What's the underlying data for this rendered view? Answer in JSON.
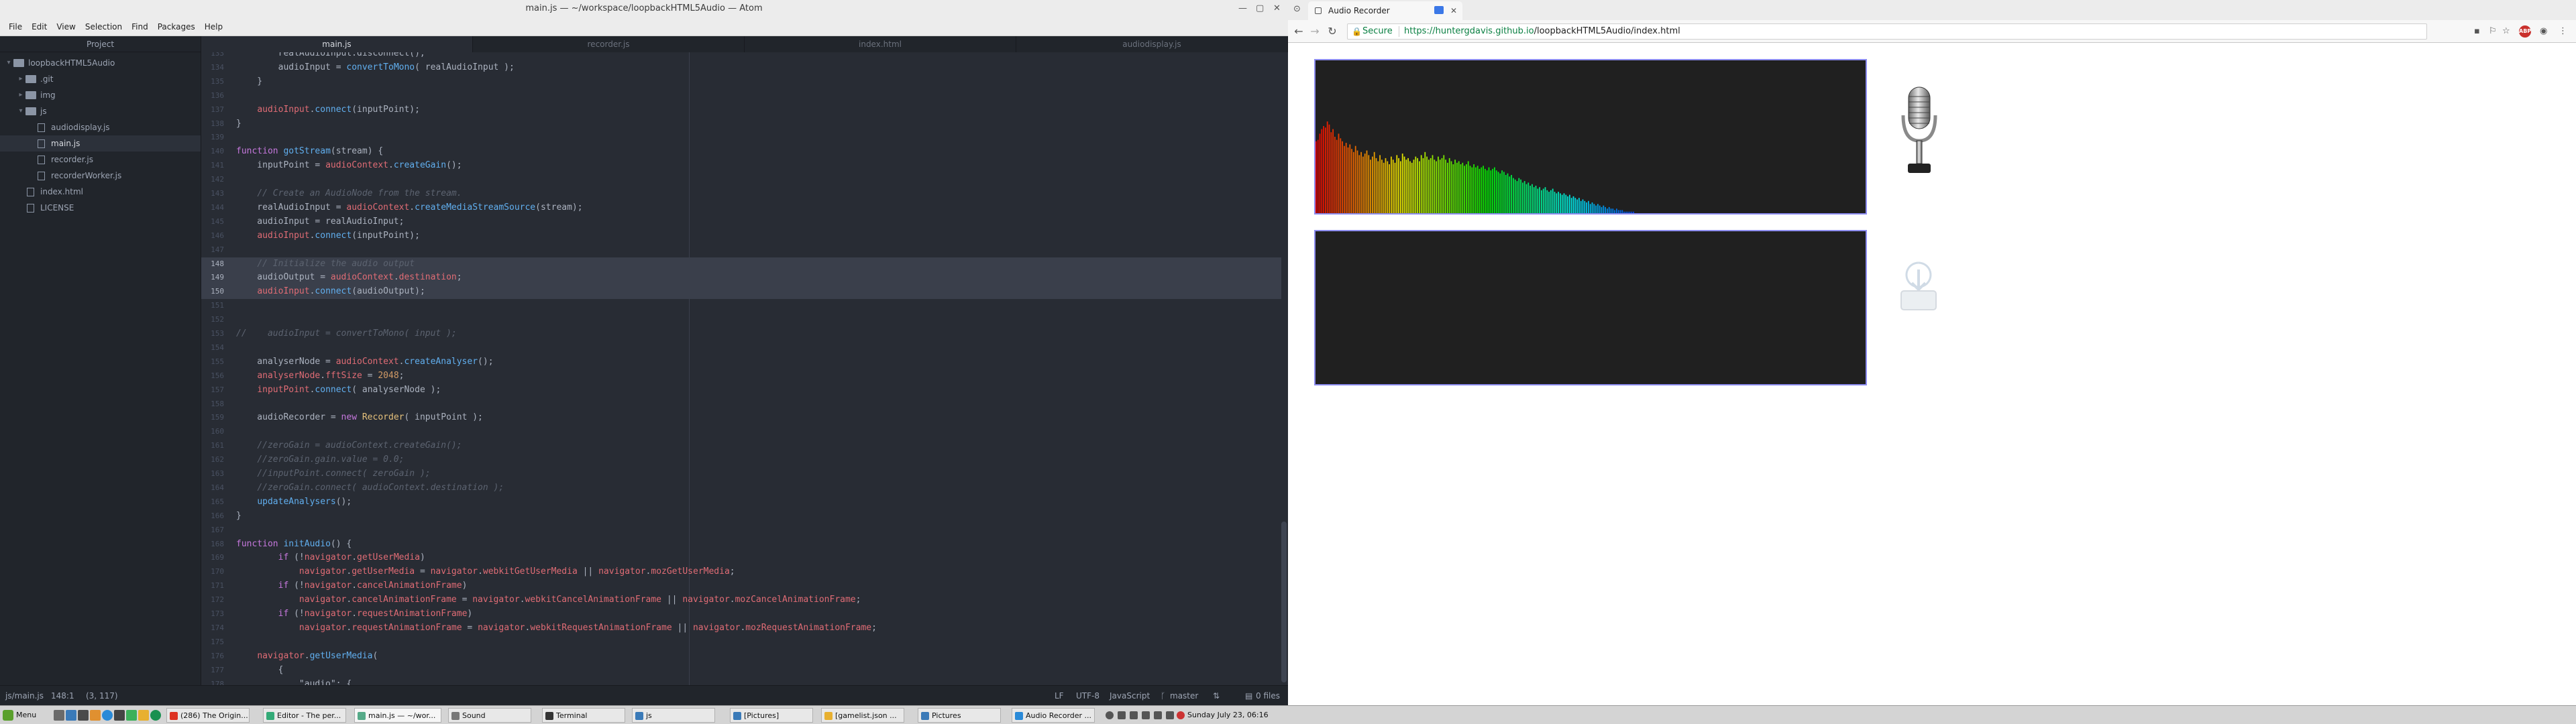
{
  "atom": {
    "title": "main.js — ~/workspace/loopbackHTML5Audio — Atom",
    "menu": [
      "File",
      "Edit",
      "View",
      "Selection",
      "Find",
      "Packages",
      "Help"
    ],
    "tree": {
      "header": "Project",
      "root": "loopbackHTML5Audio",
      "items": [
        {
          "name": ".git",
          "kind": "folder"
        },
        {
          "name": "img",
          "kind": "folder"
        },
        {
          "name": "js",
          "kind": "folder-open"
        },
        {
          "name": "audiodisplay.js",
          "kind": "file"
        },
        {
          "name": "main.js",
          "kind": "file"
        },
        {
          "name": "recorder.js",
          "kind": "file"
        },
        {
          "name": "recorderWorker.js",
          "kind": "file"
        },
        {
          "name": "index.html",
          "kind": "file"
        },
        {
          "name": "LICENSE",
          "kind": "file"
        }
      ]
    },
    "tabs": [
      "main.js",
      "recorder.js",
      "index.html",
      "audiodisplay.js"
    ],
    "status": {
      "path": "js/main.js",
      "position": "148:1",
      "selection": "(3, 117)",
      "line_ending": "LF",
      "encoding": "UTF-8",
      "grammar": "JavaScript",
      "branch": "master",
      "files": "0 files"
    },
    "code": [
      {
        "n": "133",
        "html": "        realAudioInput.disconnect();"
      },
      {
        "n": "134",
        "html": "        audioInput = <span class='fn'>convertToMono</span>( realAudioInput );"
      },
      {
        "n": "135",
        "html": "    }"
      },
      {
        "n": "136",
        "html": ""
      },
      {
        "n": "137",
        "html": "    <span class='pr'>audioInput</span>.<span class='fn'>connect</span>(inputPoint);"
      },
      {
        "n": "138",
        "html": "}"
      },
      {
        "n": "139",
        "html": ""
      },
      {
        "n": "140",
        "html": "<span class='kw'>function</span> <span class='fn'>gotStream</span>(stream) {"
      },
      {
        "n": "141",
        "html": "    inputPoint = <span class='pr'>audioContext</span>.<span class='fn'>createGain</span>();"
      },
      {
        "n": "142",
        "html": ""
      },
      {
        "n": "143",
        "html": "    <span class='cm'>// Create an AudioNode from the stream.</span>"
      },
      {
        "n": "144",
        "html": "    realAudioInput = <span class='pr'>audioContext</span>.<span class='fn'>createMediaStreamSource</span>(stream);"
      },
      {
        "n": "145",
        "html": "    audioInput = realAudioInput;"
      },
      {
        "n": "146",
        "html": "    <span class='pr'>audioInput</span>.<span class='fn'>connect</span>(inputPoint);"
      },
      {
        "n": "147",
        "html": ""
      },
      {
        "n": "148",
        "html": "    <span class='cm'>// Initialize the audio output</span>",
        "hl": true
      },
      {
        "n": "149",
        "html": "    audioOutput = <span class='pr'>audioContext</span>.<span class='pr'>destination</span>;",
        "hl": true
      },
      {
        "n": "150",
        "html": "    <span class='pr'>audioInput</span>.<span class='fn'>connect</span>(audioOutput);",
        "hl": true
      },
      {
        "n": "151",
        "html": ""
      },
      {
        "n": "152",
        "html": ""
      },
      {
        "n": "153",
        "html": "<span class='cm'>//    audioInput = convertToMono( input );</span>"
      },
      {
        "n": "154",
        "html": ""
      },
      {
        "n": "155",
        "html": "    analyserNode = <span class='pr'>audioContext</span>.<span class='fn'>createAnalyser</span>();"
      },
      {
        "n": "156",
        "html": "    <span class='pr'>analyserNode</span>.<span class='pr'>fftSize</span> = <span class='nm'>2048</span>;"
      },
      {
        "n": "157",
        "html": "    <span class='pr'>inputPoint</span>.<span class='fn'>connect</span>( analyserNode );"
      },
      {
        "n": "158",
        "html": ""
      },
      {
        "n": "159",
        "html": "    audioRecorder = <span class='kw'>new</span> <span class='cls'>Recorder</span>( inputPoint );"
      },
      {
        "n": "160",
        "html": ""
      },
      {
        "n": "161",
        "html": "    <span class='cm'>//zeroGain = audioContext.createGain();</span>"
      },
      {
        "n": "162",
        "html": "    <span class='cm'>//zeroGain.gain.value = 0.0;</span>"
      },
      {
        "n": "163",
        "html": "    <span class='cm'>//inputPoint.connect( zeroGain );</span>"
      },
      {
        "n": "164",
        "html": "    <span class='cm'>//zeroGain.connect( audioContext.destination );</span>"
      },
      {
        "n": "165",
        "html": "    <span class='fn'>updateAnalysers</span>();"
      },
      {
        "n": "166",
        "html": "}"
      },
      {
        "n": "167",
        "html": ""
      },
      {
        "n": "168",
        "html": "<span class='kw'>function</span> <span class='fn'>initAudio</span>() {"
      },
      {
        "n": "169",
        "html": "        <span class='kw'>if</span> (!<span class='pr'>navigator</span>.<span class='pr'>getUserMedia</span>)"
      },
      {
        "n": "170",
        "html": "            <span class='pr'>navigator</span>.<span class='pr'>getUserMedia</span> = <span class='pr'>navigator</span>.<span class='pr'>webkitGetUserMedia</span> || <span class='pr'>navigator</span>.<span class='pr'>mozGetUserMedia</span>;"
      },
      {
        "n": "171",
        "html": "        <span class='kw'>if</span> (!<span class='pr'>navigator</span>.<span class='pr'>cancelAnimationFrame</span>)"
      },
      {
        "n": "172",
        "html": "            <span class='pr'>navigator</span>.<span class='pr'>cancelAnimationFrame</span> = <span class='pr'>navigator</span>.<span class='pr'>webkitCancelAnimationFrame</span> || <span class='pr'>navigator</span>.<span class='pr'>mozCancelAnimationFrame</span>;"
      },
      {
        "n": "173",
        "html": "        <span class='kw'>if</span> (!<span class='pr'>navigator</span>.<span class='pr'>requestAnimationFrame</span>)"
      },
      {
        "n": "174",
        "html": "            <span class='pr'>navigator</span>.<span class='pr'>requestAnimationFrame</span> = <span class='pr'>navigator</span>.<span class='pr'>webkitRequestAnimationFrame</span> || <span class='pr'>navigator</span>.<span class='pr'>mozRequestAnimationFrame</span>;"
      },
      {
        "n": "175",
        "html": ""
      },
      {
        "n": "176",
        "html": "    <span class='pr'>navigator</span>.<span class='fn'>getUserMedia</span>("
      },
      {
        "n": "177",
        "html": "        {"
      },
      {
        "n": "178",
        "html": "            <span class='str'>\"audio\"</span>: {"
      }
    ]
  },
  "chrome": {
    "tab_title": "Audio Recorder",
    "secure_label": "Secure",
    "url_prefix": "https://huntergdavis.github.io",
    "url_path": "/loopbackHTML5Audio/index.html",
    "abp_label": "ABP",
    "spectrum_levels": [
      0.47,
      0.48,
      0.52,
      0.55,
      0.57,
      0.56,
      0.6,
      0.58,
      0.53,
      0.55,
      0.5,
      0.48,
      0.52,
      0.49,
      0.47,
      0.44,
      0.46,
      0.43,
      0.45,
      0.42,
      0.4,
      0.44,
      0.41,
      0.38,
      0.4,
      0.37,
      0.39,
      0.41,
      0.38,
      0.35,
      0.37,
      0.4,
      0.36,
      0.34,
      0.38,
      0.35,
      0.33,
      0.36,
      0.34,
      0.32,
      0.37,
      0.35,
      0.33,
      0.38,
      0.36,
      0.34,
      0.39,
      0.37,
      0.35,
      0.36,
      0.34,
      0.33,
      0.35,
      0.37,
      0.36,
      0.34,
      0.38,
      0.36,
      0.4,
      0.37,
      0.35,
      0.36,
      0.38,
      0.35,
      0.34,
      0.37,
      0.35,
      0.36,
      0.38,
      0.35,
      0.33,
      0.36,
      0.34,
      0.32,
      0.35,
      0.33,
      0.34,
      0.32,
      0.33,
      0.31,
      0.32,
      0.34,
      0.31,
      0.3,
      0.32,
      0.3,
      0.31,
      0.29,
      0.3,
      0.31,
      0.29,
      0.28,
      0.3,
      0.28,
      0.29,
      0.3,
      0.28,
      0.27,
      0.26,
      0.28,
      0.27,
      0.25,
      0.26,
      0.24,
      0.25,
      0.23,
      0.22,
      0.21,
      0.23,
      0.22,
      0.2,
      0.21,
      0.19,
      0.2,
      0.18,
      0.19,
      0.17,
      0.18,
      0.16,
      0.17,
      0.15,
      0.16,
      0.17,
      0.15,
      0.14,
      0.15,
      0.16,
      0.14,
      0.13,
      0.14,
      0.13,
      0.12,
      0.13,
      0.12,
      0.11,
      0.12,
      0.1,
      0.11,
      0.1,
      0.09,
      0.1,
      0.08,
      0.09,
      0.08,
      0.07,
      0.08,
      0.06,
      0.07,
      0.06,
      0.05,
      0.06,
      0.05,
      0.04,
      0.05,
      0.04,
      0.03,
      0.04,
      0.03,
      0.03,
      0.02,
      0.03,
      0.02,
      0.02,
      0.02,
      0.01,
      0.01,
      0.01,
      0.01,
      0.01,
      0.01,
      0,
      0,
      0,
      0,
      0
    ]
  },
  "taskbar": {
    "menu": "Menu",
    "items": [
      {
        "label": "(286) The Origin..."
      },
      {
        "label": "Editor - The per..."
      },
      {
        "label": "main.js — ~/wor...",
        "active": true
      },
      {
        "label": "Sound"
      },
      {
        "label": "Terminal"
      },
      {
        "label": "js"
      },
      {
        "label": "[Pictures]"
      },
      {
        "label": "[gamelist.json ..."
      },
      {
        "label": "Pictures"
      },
      {
        "label": "Audio Recorder ..."
      }
    ],
    "clock": "Sunday July 23, 06:16"
  }
}
